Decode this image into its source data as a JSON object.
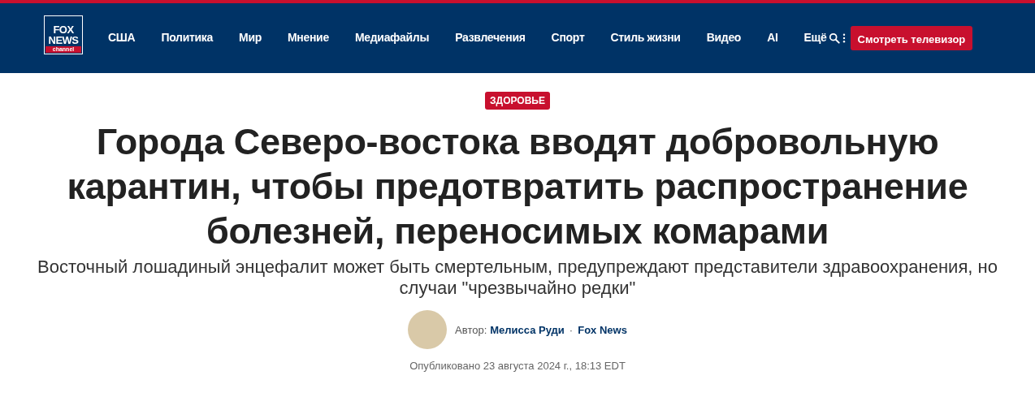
{
  "logo": {
    "line_1": "FOX",
    "line_2": "NEWS",
    "line_3": "channel"
  },
  "nav": {
    "items": [
      {
        "label": "США"
      },
      {
        "label": "Политика"
      },
      {
        "label": "Мир"
      },
      {
        "label": "Мнение"
      },
      {
        "label": "Медиафайлы"
      },
      {
        "label": "Развлечения"
      },
      {
        "label": "Спорт"
      },
      {
        "label": "Стиль жизни"
      },
      {
        "label": "Видео"
      },
      {
        "label": "AI"
      },
      {
        "label": "Ещё"
      }
    ],
    "watch_button": "Смотреть телевизор"
  },
  "article": {
    "category": "ЗДОРОВЬЕ",
    "title": "Города Северо-востока вводят добровольную карантин, чтобы предотвратить распространение болезней, переносимых комарами",
    "subtitle": "Восточный лошадиный энцефалит может быть смертельным, предупреждают представители здравоохранения, но случаи \"чрезвычайно редки\"",
    "byline": {
      "prefix": "Автор:",
      "author": "Мелисса Руди",
      "separator": "·",
      "source": "Fox News"
    },
    "published": "Опубликовано 23 августа 2024 г., 18:13 EDT"
  }
}
